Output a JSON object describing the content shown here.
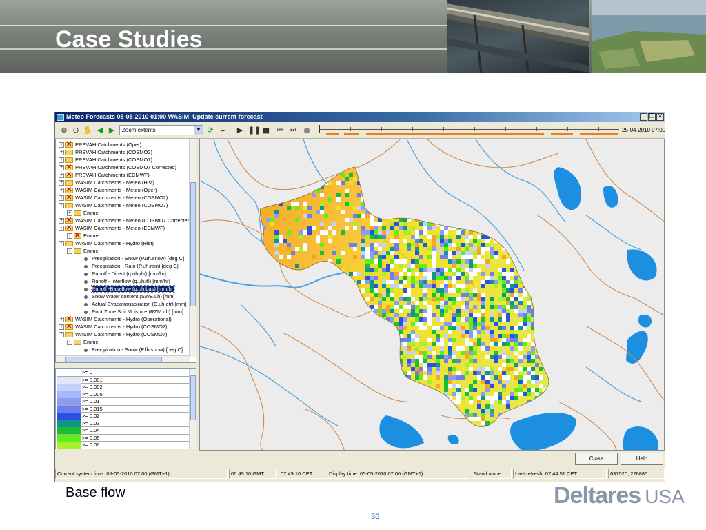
{
  "slide": {
    "title": "Case Studies",
    "caption": "Base flow",
    "page_number": "36",
    "logo_brand": "Deltares",
    "logo_region": "USA"
  },
  "window": {
    "title": "Meteo Forecasts 05-05-2010 01:00 WASIM_Update current forecast",
    "controls": [
      "_",
      "❐",
      "✕"
    ]
  },
  "toolbar": {
    "zoom_select_value": "Zoom extents",
    "time_readout": "25-04-2010 07:00",
    "icons": [
      "zoom-in-icon",
      "zoom-out-icon",
      "pan-hand-icon",
      "back-icon",
      "forward-icon",
      "refresh-icon",
      "step-icon",
      "play-icon",
      "pause-icon",
      "stop-icon",
      "skip-back-icon",
      "skip-forward-icon",
      "record-icon"
    ]
  },
  "tree": {
    "items": [
      {
        "label": "PREVAH Catchments (Oper)",
        "level": 0,
        "exp": "+",
        "icon": "xfolder"
      },
      {
        "label": "PREVAH Catchments (COSMO2)",
        "level": 0,
        "exp": "+",
        "icon": "folder"
      },
      {
        "label": "PREVAH Catchments (COSMO7)",
        "level": 0,
        "exp": "+",
        "icon": "folder"
      },
      {
        "label": "PREVAH Catchments (COSMO7 Corrected)",
        "level": 0,
        "exp": "+",
        "icon": "xfolder"
      },
      {
        "label": "PREVAH Catchments (ECMWF)",
        "level": 0,
        "exp": "+",
        "icon": "xfolder"
      },
      {
        "label": "WASIM Catchments - Meteo  (Hist)",
        "level": 0,
        "exp": "+",
        "icon": "folder"
      },
      {
        "label": "WASIM Catchments - Meteo  (Oper)",
        "level": 0,
        "exp": "+",
        "icon": "xfolder"
      },
      {
        "label": "WASIM Catchments - Meteo  (COSMO2)",
        "level": 0,
        "exp": "+",
        "icon": "xfolder"
      },
      {
        "label": "WASIM Catchments - Meteo  (COSMO7)",
        "level": 0,
        "exp": "-",
        "icon": "folder"
      },
      {
        "label": "Emme",
        "level": 1,
        "exp": "+",
        "icon": "folder"
      },
      {
        "label": "WASIM Catchments - Meteo  (COSMO7 Corrected)",
        "level": 0,
        "exp": "+",
        "icon": "xfolder"
      },
      {
        "label": "WASIM Catchments - Meteo  (ECMWF)",
        "level": 0,
        "exp": "-",
        "icon": "xfolder"
      },
      {
        "label": "Emme",
        "level": 1,
        "exp": "+",
        "icon": "xfolder"
      },
      {
        "label": "WASIM Catchments - Hydro  (Hist)",
        "level": 0,
        "exp": "-",
        "icon": "folder"
      },
      {
        "label": "Emme",
        "level": 1,
        "exp": "-",
        "icon": "folder"
      },
      {
        "label": "Precipitation - Snow  (P.uh.snow) [deg C]",
        "level": 2,
        "exp": "",
        "icon": "dot"
      },
      {
        "label": "Precipitation - Rain  (P.uh.rain) [deg C]",
        "level": 2,
        "exp": "",
        "icon": "dot"
      },
      {
        "label": "Runoff - Direct  (q.uh.dir) [mm/hr]",
        "level": 2,
        "exp": "",
        "icon": "dot"
      },
      {
        "label": "Runoff - Interflow  (q.uh.ifl) [mm/hr]",
        "level": 2,
        "exp": "",
        "icon": "dot"
      },
      {
        "label": "Runoff -Baseflow  (q.uh.bas) [mm/hr]",
        "level": 2,
        "exp": "",
        "icon": "dot",
        "selected": true
      },
      {
        "label": "Snow Water content (SWE.uh) [mm]",
        "level": 2,
        "exp": "",
        "icon": "dot"
      },
      {
        "label": "Actual Evapotranspiration (E.uh.etr)  [mm]",
        "level": 2,
        "exp": "",
        "icon": "dot"
      },
      {
        "label": "Root Zone Soil Moisture  (RZM.uh) [mm]",
        "level": 2,
        "exp": "",
        "icon": "dot"
      },
      {
        "label": "WASIM Catchments - Hydro  (Operational)",
        "level": 0,
        "exp": "+",
        "icon": "xfolder"
      },
      {
        "label": "WASIM Catchments - Hydro  (COSMO2)",
        "level": 0,
        "exp": "+",
        "icon": "xfolder"
      },
      {
        "label": "WASIM Catchments - Hydro  (COSMO7)",
        "level": 0,
        "exp": "-",
        "icon": "folder"
      },
      {
        "label": "Emme",
        "level": 1,
        "exp": "-",
        "icon": "folder"
      },
      {
        "label": "Precipitation - Snow  (P.fh.snow) [deg C]",
        "level": 2,
        "exp": "",
        "icon": "dot"
      }
    ]
  },
  "legend": {
    "items": [
      {
        "label": ">= 0",
        "color": "#ffffff"
      },
      {
        "label": ">= 0.001",
        "color": "#dfe6fb"
      },
      {
        "label": ">= 0.002",
        "color": "#c4d2fa"
      },
      {
        "label": ">= 0.005",
        "color": "#a6b8f6"
      },
      {
        "label": ">= 0.01",
        "color": "#8c9cf2"
      },
      {
        "label": ">= 0.015",
        "color": "#6a7ff0"
      },
      {
        "label": ">= 0.02",
        "color": "#2a52e0"
      },
      {
        "label": ">= 0.03",
        "color": "#12948c"
      },
      {
        "label": ">= 0.04",
        "color": "#16c032"
      },
      {
        "label": ">= 0.05",
        "color": "#5ff01a"
      },
      {
        "label": ">= 0.06",
        "color": "#a8f02a"
      }
    ]
  },
  "buttons": {
    "close": "Close",
    "help": "Help"
  },
  "status": {
    "current_time": "Current system time: 05-05-2010 07:00 (GMT+1)",
    "gmt": "06:49:10 GMT",
    "cet": "07:49:10 CET",
    "display_time": "Display time: 05-05-2010 07:00 (GMT+1)",
    "mode": "Stand alone",
    "last_refresh": "Last refresh: 07:44:51 CET",
    "coords": "637520, 226885"
  },
  "colors": {
    "selection": "#0a246a",
    "timeline_bar": "#f07d1e",
    "lake": "#1c8fe0",
    "river": "#4aa0e0",
    "border": "#d08b4a",
    "catchment_orange": "#f5a623",
    "catchment_yellow": "#f2e12a"
  }
}
